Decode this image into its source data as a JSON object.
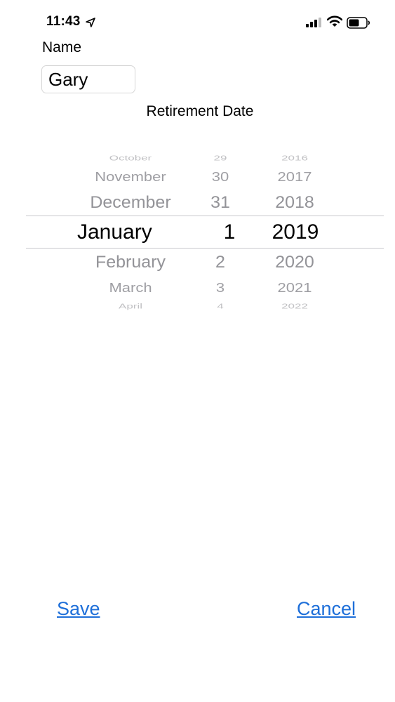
{
  "status_bar": {
    "time": "11:43",
    "icons": [
      "location-arrow-icon",
      "cellular-signal-icon",
      "wifi-icon",
      "battery-icon"
    ]
  },
  "form": {
    "name_label": "Name",
    "name_value": "Gary",
    "section_title": "Retirement Date"
  },
  "picker": {
    "selected": {
      "month": "January",
      "day": "1",
      "year": "2019"
    },
    "rows": [
      {
        "month": "October",
        "day": "29",
        "year": "2016"
      },
      {
        "month": "November",
        "day": "30",
        "year": "2017"
      },
      {
        "month": "December",
        "day": "31",
        "year": "2018"
      },
      {
        "month": "January",
        "day": "1",
        "year": "2019"
      },
      {
        "month": "February",
        "day": "2",
        "year": "2020"
      },
      {
        "month": "March",
        "day": "3",
        "year": "2021"
      },
      {
        "month": "April",
        "day": "4",
        "year": "2022"
      }
    ]
  },
  "actions": {
    "save_label": "Save",
    "cancel_label": "Cancel"
  },
  "colors": {
    "link": "#1e6fd9",
    "picker_text_unselected": "#8e8e93",
    "picker_divider": "#c8c8cc"
  }
}
